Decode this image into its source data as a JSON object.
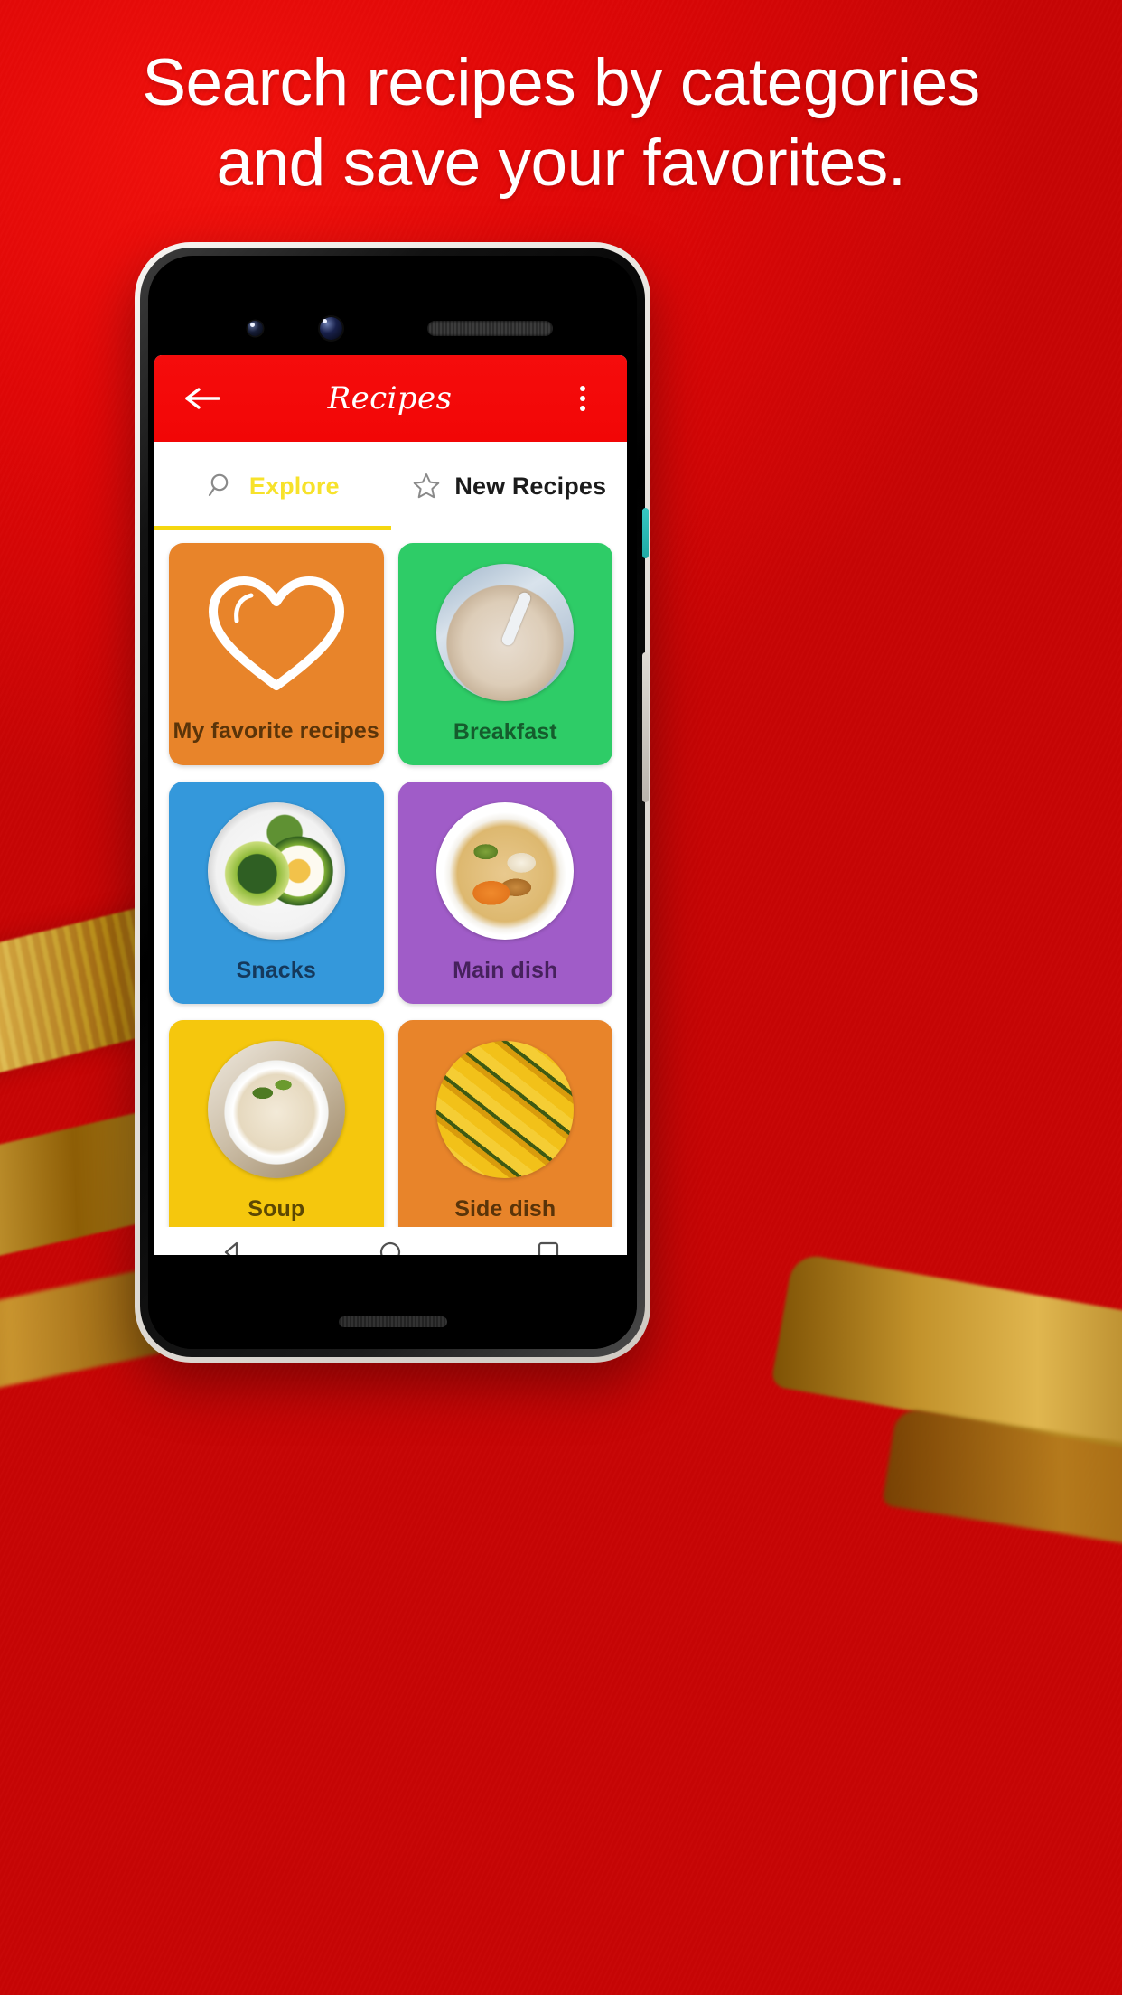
{
  "promo": {
    "headline_line1": "Search recipes by categories",
    "headline_line2": "and save your favorites.",
    "background_color": "#e3000b",
    "headline_color": "#ffffff"
  },
  "app": {
    "appbar": {
      "back_icon": "arrow-left-icon",
      "title": "Recipes",
      "menu_icon": "overflow-menu-icon",
      "background_color": "#f50c0c",
      "title_color": "#ffffff"
    },
    "tabs": [
      {
        "label": "Explore",
        "icon": "search-icon",
        "active": true,
        "color": "#f7e22b"
      },
      {
        "label": "New Recipes",
        "icon": "star-outline-icon",
        "active": false,
        "color": "#1b1b1b"
      }
    ],
    "tab_indicator_color": "#f5d70f",
    "categories": [
      {
        "label": "My favorite recipes",
        "color": "#e8842a",
        "text_color": "#5a3409",
        "icon": "heart-outline-icon"
      },
      {
        "label": "Breakfast",
        "color": "#2ecc67",
        "text_color": "#155c2d",
        "icon": "food-thumb-porridge"
      },
      {
        "label": "Snacks",
        "color": "#3498db",
        "text_color": "#15395c",
        "icon": "food-thumb-avocado"
      },
      {
        "label": "Main dish",
        "color": "#a05cc8",
        "text_color": "#46215c",
        "icon": "food-thumb-soup-meat"
      },
      {
        "label": "Soup",
        "color": "#f5c70d",
        "text_color": "#5c4803",
        "icon": "food-thumb-soup-bowl"
      },
      {
        "label": "Side dish",
        "color": "#e8842a",
        "text_color": "#5a3409",
        "icon": "food-thumb-squash"
      },
      {
        "label": "",
        "color": "#e8605a",
        "text_color": "#5c211e",
        "icon": "food-thumb-mango-sticky-rice"
      },
      {
        "label": "",
        "color": "#2ecc67",
        "text_color": "#155c2d",
        "icon": "food-thumb-tofu"
      }
    ],
    "navbar": [
      {
        "icon": "back-triangle-icon"
      },
      {
        "icon": "home-circle-icon"
      },
      {
        "icon": "recents-square-icon"
      }
    ]
  }
}
